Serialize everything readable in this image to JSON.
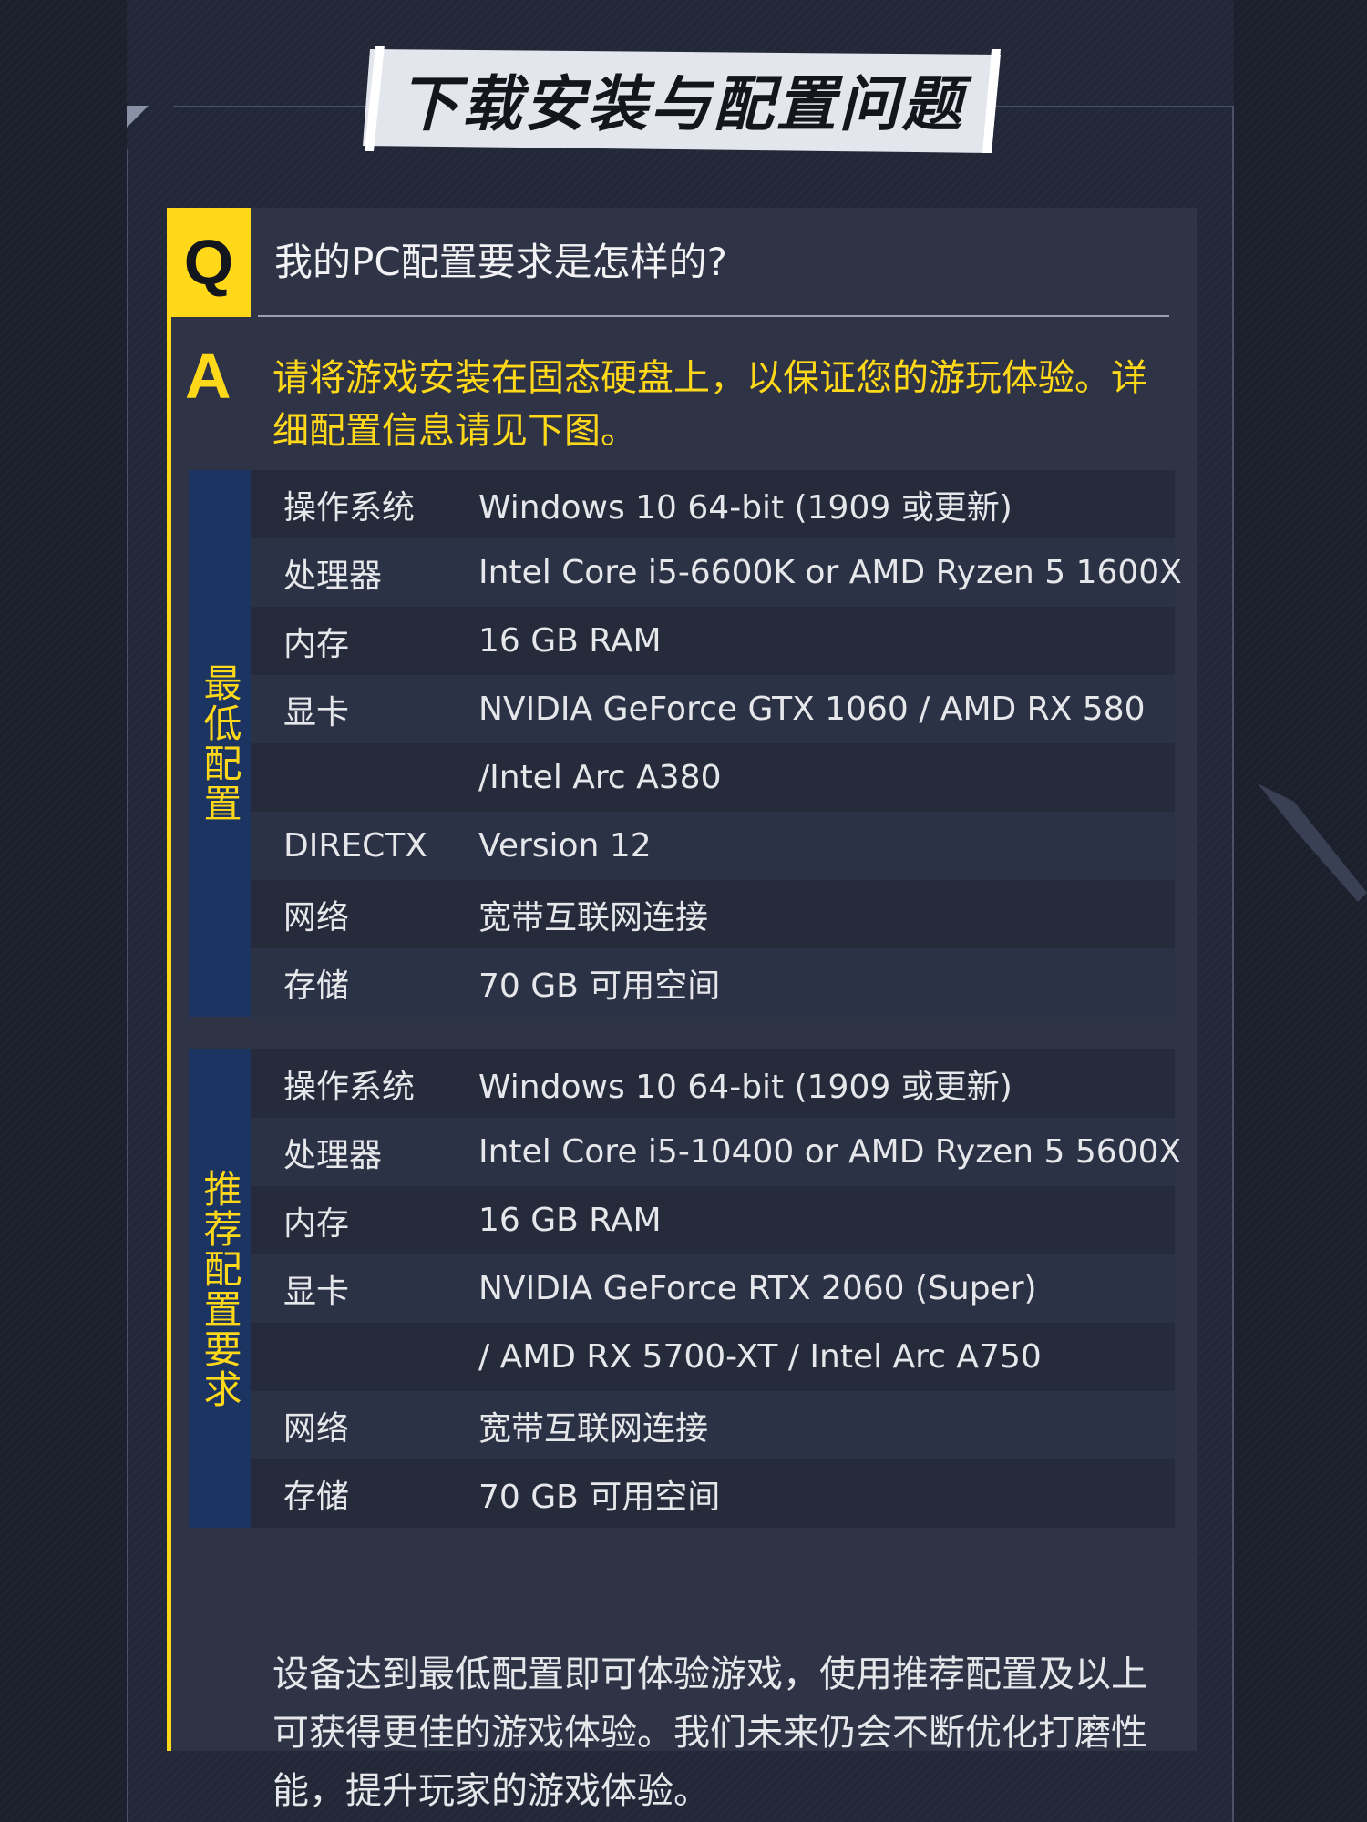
{
  "title": "下载安装与配置问题",
  "question": {
    "badge": "Q",
    "text": "我的PC配置要求是怎样的?"
  },
  "answer": {
    "badge": "A",
    "text": "请将游戏安装在固态硬盘上，以保证您的游玩体验。详细配置信息请见下图。"
  },
  "min_spec": {
    "label": "最低配置",
    "rows": [
      {
        "key": "操作系统",
        "value": "Windows 10 64-bit (1909 或更新)"
      },
      {
        "key": "处理器",
        "value": "Intel Core i5-6600K or AMD Ryzen 5 1600X"
      },
      {
        "key": "内存",
        "value": "16 GB RAM"
      },
      {
        "key": "显卡",
        "value": "NVIDIA GeForce GTX 1060 / AMD RX 580"
      },
      {
        "key": "",
        "value": "/Intel Arc A380"
      },
      {
        "key": "DIRECTX",
        "value": "Version 12"
      },
      {
        "key": "网络",
        "value": "宽带互联网连接"
      },
      {
        "key": "存储",
        "value": "70 GB 可用空间"
      }
    ]
  },
  "rec_spec": {
    "label": "推荐配置要求",
    "rows": [
      {
        "key": "操作系统",
        "value": "Windows 10 64-bit (1909 或更新)"
      },
      {
        "key": "处理器",
        "value": "Intel Core i5-10400 or AMD Ryzen 5 5600X"
      },
      {
        "key": "内存",
        "value": "16 GB RAM"
      },
      {
        "key": "显卡",
        "value": "NVIDIA GeForce RTX 2060 (Super)"
      },
      {
        "key": "",
        "value": "/ AMD RX 5700-XT / Intel Arc A750"
      },
      {
        "key": "网络",
        "value": "宽带互联网连接"
      },
      {
        "key": "存储",
        "value": "70 GB 可用空间"
      }
    ]
  },
  "footer": "设备达到最低配置即可体验游戏，使用推荐配置及以上可获得更佳的游戏体验。我们未来仍会不断优化打磨性能，提升玩家的游戏体验。",
  "colors": {
    "accent": "#ffd81a",
    "side_label_bg": "#1b3461",
    "card_bg": "#2e3346"
  }
}
